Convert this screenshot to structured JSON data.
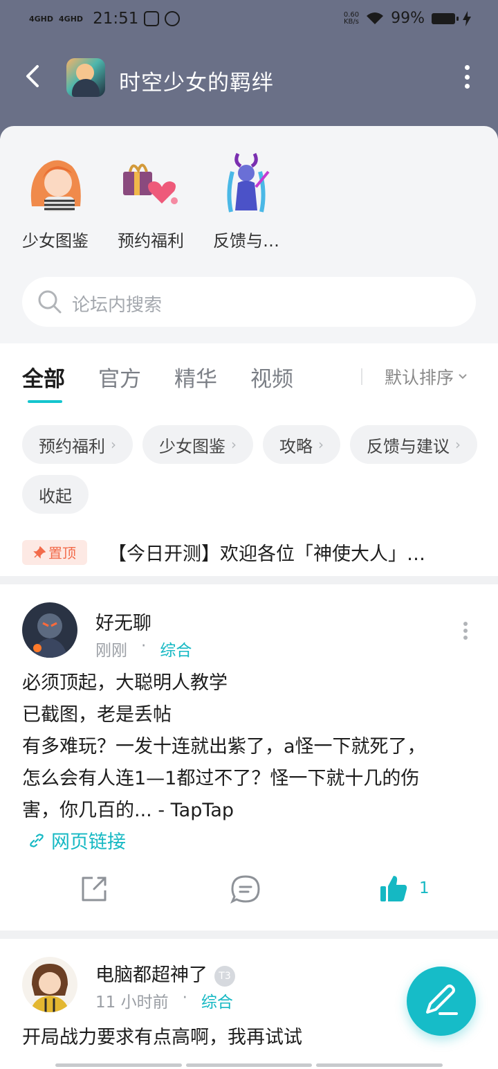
{
  "status_bar": {
    "network1": "4GHD",
    "network2": "4GHD",
    "time": "21:51",
    "speed_value": "0.60",
    "speed_unit": "KB/s",
    "battery": "99%"
  },
  "header": {
    "title": "时空少女的羁绊"
  },
  "shortcuts": [
    {
      "label": "少女图鉴"
    },
    {
      "label": "预约福利"
    },
    {
      "label": "反馈与…"
    }
  ],
  "search": {
    "placeholder": "论坛内搜索"
  },
  "tabs": [
    {
      "label": "全部",
      "active": true
    },
    {
      "label": "官方",
      "active": false
    },
    {
      "label": "精华",
      "active": false
    },
    {
      "label": "视频",
      "active": false
    }
  ],
  "sort": {
    "label": "默认排序"
  },
  "chips": [
    {
      "label": "预约福利",
      "arrow": "›"
    },
    {
      "label": "少女图鉴",
      "arrow": "›"
    },
    {
      "label": "攻略",
      "arrow": "›"
    },
    {
      "label": "反馈与建议",
      "arrow": "›"
    },
    {
      "label": "收起",
      "arrow": ""
    }
  ],
  "pinned": {
    "badge": "置顶",
    "text": "【今日开测】欢迎各位「神使大人」…"
  },
  "posts": [
    {
      "author": "好无聊",
      "time": "刚刚",
      "category": "综合",
      "body_lines": [
        "必须顶起，大聪明人教学",
        "已截图，老是丢帖",
        "有多难玩？一发十连就出紫了，a怪一下就死了，",
        "怎么会有人连1—1都过不了？怪一下就十几的伤",
        "害，你几百的... - TapTap"
      ],
      "link_label": "网页链接",
      "likes": "1"
    },
    {
      "author": "电脑都超神了",
      "level_badge": "T3",
      "time": "11 小时前",
      "category": "综合",
      "body_lines": [
        "开局战力要求有点高啊，我再试试"
      ]
    }
  ],
  "colors": {
    "accent": "#15c5ce",
    "header_bg": "#6a7087",
    "pin_bg": "#fde9e4",
    "pin_text": "#f26b4b"
  }
}
